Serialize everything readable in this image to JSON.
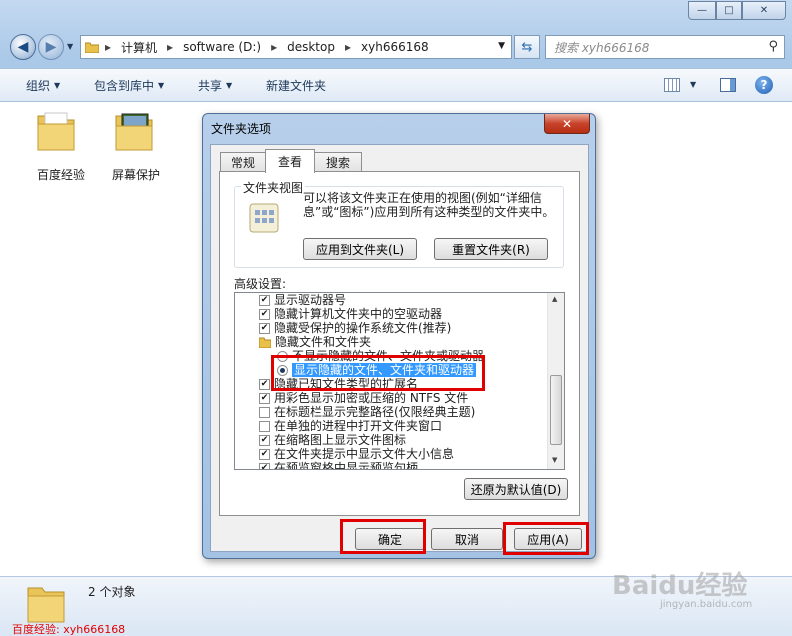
{
  "explorer": {
    "address": {
      "segments": [
        "计算机",
        "software (D:)",
        "desktop",
        "xyh666168"
      ]
    },
    "search": {
      "placeholder": "搜索 xyh666168"
    },
    "toolbar": {
      "organize": "组织",
      "include_in_library": "包含到库中",
      "share": "共享",
      "new_folder": "新建文件夹"
    },
    "files": [
      {
        "name": "百度经验"
      },
      {
        "name": "屏幕保护"
      }
    ],
    "status": {
      "count": "2 个对象"
    }
  },
  "dialog": {
    "title": "文件夹选项",
    "tabs": [
      "常规",
      "查看",
      "搜索"
    ],
    "active_tab": "查看",
    "folder_views": {
      "title": "文件夹视图",
      "description": "可以将该文件夹正在使用的视图(例如“详细信息”或“图标”)应用到所有这种类型的文件夹中。",
      "apply_button": "应用到文件夹(L)",
      "reset_button": "重置文件夹(R)"
    },
    "advanced": {
      "label": "高级设置:",
      "items": [
        {
          "text": "显示驱动器号",
          "kind": "checkbox",
          "checked": true
        },
        {
          "text": "隐藏计算机文件夹中的空驱动器",
          "kind": "checkbox",
          "checked": true
        },
        {
          "text": "隐藏受保护的操作系统文件(推荐)",
          "kind": "checkbox",
          "checked": true
        },
        {
          "text": "隐藏文件和文件夹",
          "kind": "folder"
        },
        {
          "text": "不显示隐藏的文件、文件夹或驱动器",
          "kind": "radio",
          "checked": false
        },
        {
          "text": "显示隐藏的文件、文件夹和驱动器",
          "kind": "radio",
          "checked": true
        },
        {
          "text": "隐藏已知文件类型的扩展名",
          "kind": "checkbox",
          "checked": true
        },
        {
          "text": "用彩色显示加密或压缩的 NTFS 文件",
          "kind": "checkbox",
          "checked": true
        },
        {
          "text": "在标题栏显示完整路径(仅限经典主题)",
          "kind": "checkbox",
          "checked": false
        },
        {
          "text": "在单独的进程中打开文件夹窗口",
          "kind": "checkbox",
          "checked": false
        },
        {
          "text": "在缩略图上显示文件图标",
          "kind": "checkbox",
          "checked": true
        },
        {
          "text": "在文件夹提示中显示文件大小信息",
          "kind": "checkbox",
          "checked": true
        },
        {
          "text": "在预览窗格中显示预览句柄",
          "kind": "checkbox",
          "checked": true
        }
      ]
    },
    "restore_defaults": "还原为默认值(D)",
    "ok": "确定",
    "cancel": "取消",
    "apply": "应用(A)"
  },
  "watermark": {
    "caption": "百度经验: xyh666168",
    "logo_text": "Baidu经验",
    "url": "jingyan.baidu.com"
  },
  "colors": {
    "highlight": "#3399ff",
    "annotation": "#e00000"
  }
}
